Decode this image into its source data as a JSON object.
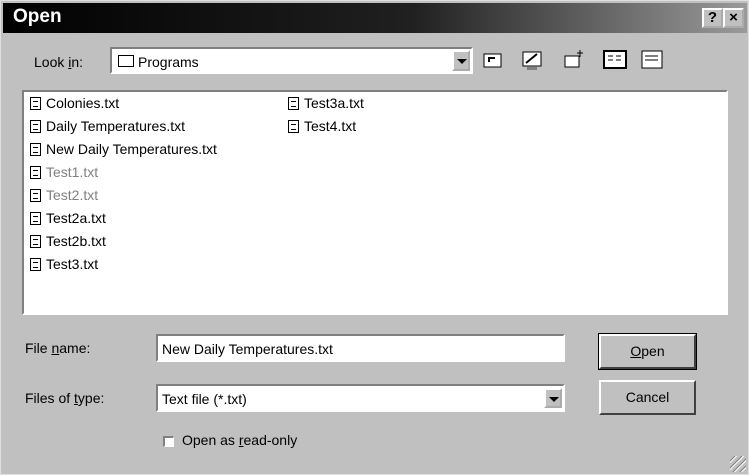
{
  "window": {
    "title": "Open",
    "help_label": "?",
    "close_label": "×"
  },
  "look_in": {
    "label_before": "Look ",
    "label_mnemonic": "i",
    "label_after": "n:",
    "value": "Programs",
    "folder_icon": "folder-icon"
  },
  "toolbar": [
    "up-one-level-icon",
    "desktop-icon",
    "new-folder-icon",
    "list-view-icon",
    "details-view-icon"
  ],
  "files": {
    "column1": [
      {
        "name": "Colonies.txt",
        "state": "normal"
      },
      {
        "name": "Daily Temperatures.txt",
        "state": "normal"
      },
      {
        "name": "New Daily Temperatures.txt",
        "state": "normal"
      },
      {
        "name": "Test1.txt",
        "state": "grayed"
      },
      {
        "name": "Test2.txt",
        "state": "grayed"
      },
      {
        "name": "Test2a.txt",
        "state": "normal"
      },
      {
        "name": "Test2b.txt",
        "state": "normal"
      },
      {
        "name": "Test3.txt",
        "state": "normal"
      }
    ],
    "column2": [
      {
        "name": "Test3a.txt",
        "state": "normal"
      },
      {
        "name": "Test4.txt",
        "state": "normal"
      }
    ]
  },
  "file_name": {
    "label_before": "File ",
    "label_mnemonic": "n",
    "label_after": "ame:",
    "value": "New Daily Temperatures.txt"
  },
  "file_type": {
    "label_before": "Files of ",
    "label_mnemonic": "t",
    "label_after": "ype:",
    "value": "Text file (*.txt)"
  },
  "buttons": {
    "open_mnemonic": "O",
    "open_rest": "pen",
    "cancel": "Cancel"
  },
  "read_only": {
    "checked": false,
    "label_before": "Open as ",
    "label_mnemonic": "r",
    "label_after": "ead-only"
  }
}
